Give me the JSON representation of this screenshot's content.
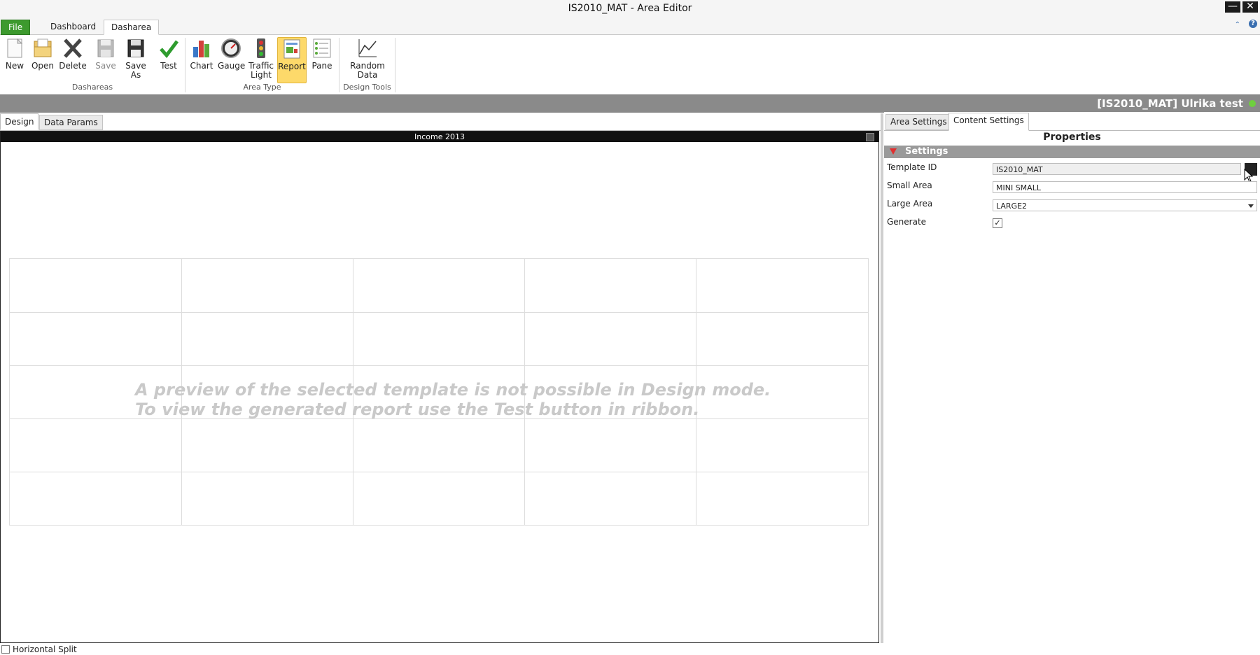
{
  "window": {
    "title": "IS2010_MAT - Area Editor",
    "minimize_glyph": "—",
    "close_glyph": "✕"
  },
  "ribbon_tabs": [
    {
      "label": "File"
    },
    {
      "label": "Dashboard"
    },
    {
      "label": "Dasharea"
    }
  ],
  "ribbon": {
    "groups": [
      {
        "label": "Dashareas"
      },
      {
        "label": "Area Type"
      },
      {
        "label": "Design Tools"
      }
    ],
    "buttons": {
      "new": {
        "label": "New",
        "icon": "new-document-icon"
      },
      "open": {
        "label": "Open",
        "icon": "open-folder-icon"
      },
      "delete": {
        "label": "Delete",
        "icon": "delete-x-icon"
      },
      "save": {
        "label": "Save",
        "icon": "floppy-disk-icon"
      },
      "save_as_1": {
        "label": "Save"
      },
      "save_as_2": {
        "label": "As"
      },
      "test": {
        "label": "Test",
        "icon": "checkmark-icon"
      },
      "chart": {
        "label": "Chart",
        "icon": "bar-chart-icon"
      },
      "gauge": {
        "label": "Gauge",
        "icon": "gauge-icon"
      },
      "traffic_1": {
        "label": "Traffic"
      },
      "traffic_2": {
        "label": "Light"
      },
      "report": {
        "label": "Report",
        "icon": "report-icon"
      },
      "pane": {
        "label": "Pane",
        "icon": "pane-icon"
      },
      "random_1": {
        "label": "Random"
      },
      "random_2": {
        "label": "Data"
      }
    }
  },
  "status": {
    "title": "[IS2010_MAT] Ulrika test",
    "accent": "#6fcf3f"
  },
  "left_tabs": [
    {
      "label": "Design"
    },
    {
      "label": "Data Params"
    }
  ],
  "pane": {
    "title": "Income 2013",
    "preview_line1": "A preview of the selected template is not possible in Design mode.",
    "preview_line2": "To view the generated report use the Test button in ribbon."
  },
  "horizontal_split": {
    "label": "Horizontal Split",
    "checked": false
  },
  "right_tabs": [
    {
      "label": "Area Settings"
    },
    {
      "label": "Content Settings"
    }
  ],
  "properties": {
    "title": "Properties",
    "section": "Settings",
    "template_id": {
      "label": "Template ID",
      "value": "IS2010_MAT"
    },
    "small_area": {
      "label": "Small Area",
      "value": "MINI  SMALL"
    },
    "large_area": {
      "label": "Large Area",
      "value": "LARGE2"
    },
    "generate": {
      "label": "Generate",
      "checked": true,
      "mark": "✓"
    }
  }
}
